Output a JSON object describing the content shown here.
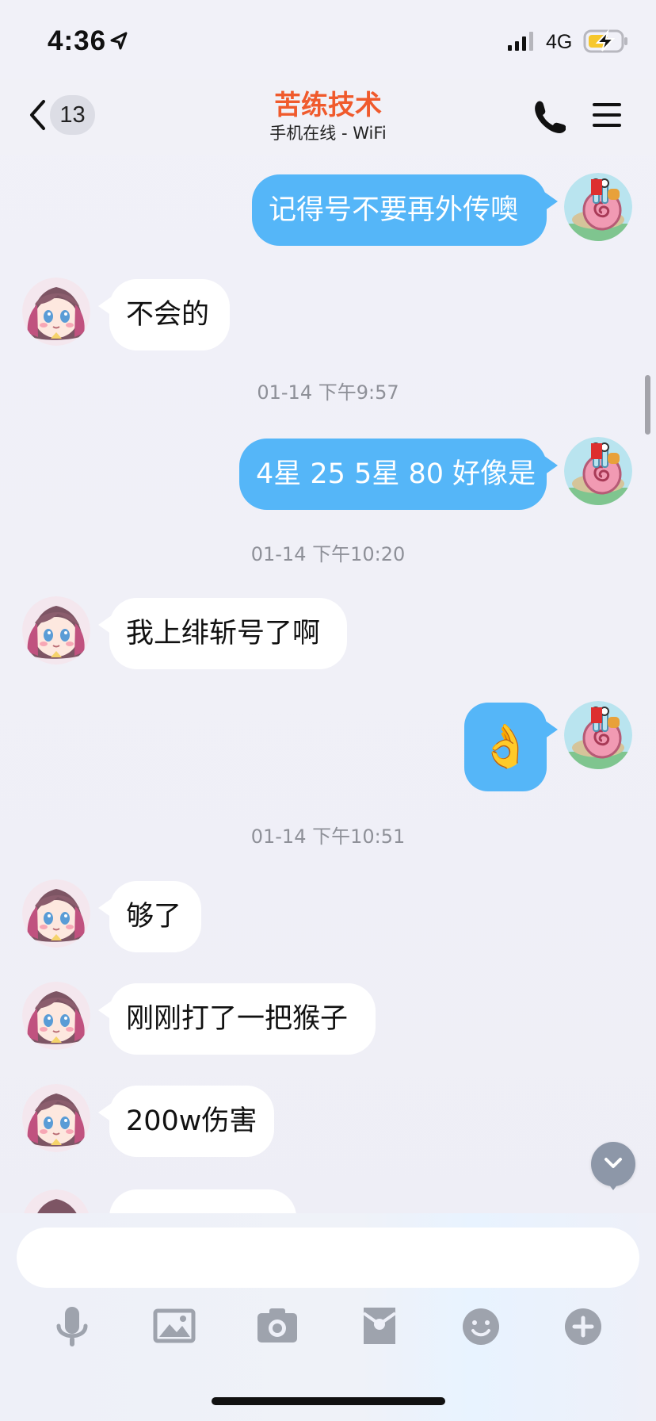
{
  "status_bar": {
    "time": "4:36",
    "network": "4G",
    "icons": [
      "location-arrow-icon",
      "signal-icon",
      "battery-charging-icon"
    ]
  },
  "header": {
    "unread_count": "13",
    "title": "苦练技术",
    "subtitle": "手机在线 - WiFi",
    "icons": [
      "back-chevron-icon",
      "phone-icon",
      "menu-icon"
    ],
    "title_color": "#f05a2c"
  },
  "messages": [
    {
      "side": "sent",
      "text": "记得号不要再外传噢"
    },
    {
      "side": "received",
      "text": "不会的"
    },
    {
      "timestamp": "01-14 下午9:57"
    },
    {
      "side": "sent",
      "text": "4星 25 5星 80 好像是"
    },
    {
      "timestamp": "01-14 下午10:20"
    },
    {
      "side": "received",
      "text": "我上绯斩号了啊"
    },
    {
      "side": "sent",
      "emoji": "👌"
    },
    {
      "timestamp": "01-14 下午10:51"
    },
    {
      "side": "received",
      "text": "够了"
    },
    {
      "side": "received",
      "text": "刚刚打了一把猴子"
    },
    {
      "side": "received",
      "text": "200w伤害"
    }
  ],
  "input": {
    "value": "",
    "placeholder": ""
  },
  "toolbar": {
    "icons": [
      "microphone-icon",
      "image-icon",
      "camera-icon",
      "red-envelope-icon",
      "emoji-icon",
      "plus-icon"
    ]
  },
  "colors": {
    "sent_bubble": "#55b6f8",
    "received_bubble": "#ffffff",
    "background": "#efeff6",
    "toolbar_icon": "#9ea3ad"
  }
}
